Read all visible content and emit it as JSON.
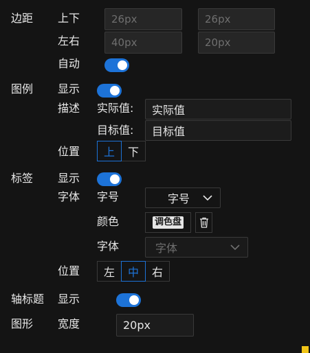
{
  "margin": {
    "section_label": "边距",
    "vertical_label": "上下",
    "horizontal_label": "左右",
    "auto_label": "自动",
    "auto_on": true,
    "top": {
      "placeholder": "26px"
    },
    "bottom": {
      "placeholder": "26px"
    },
    "left": {
      "placeholder": "40px"
    },
    "right": {
      "placeholder": "20px"
    }
  },
  "legend": {
    "section_label": "图例",
    "show_label": "显示",
    "show_on": true,
    "desc_label": "描述",
    "actual_label": "实际值:",
    "actual_value": "实际值",
    "target_label": "目标值:",
    "target_value": "目标值",
    "position_label": "位置",
    "position_options": [
      "上",
      "下"
    ],
    "position_selected": "上"
  },
  "label": {
    "section_label": "标签",
    "show_label": "显示",
    "show_on": true,
    "font_label": "字体",
    "size_label": "字号",
    "size_value": "字号",
    "color_label": "颜色",
    "color_button": "调色盘",
    "family_label": "字体",
    "family_placeholder": "字体",
    "position_label": "位置",
    "position_options": [
      "左",
      "中",
      "右"
    ],
    "position_selected": "中"
  },
  "axis_title": {
    "section_label": "轴标题",
    "show_label": "显示",
    "show_on": true
  },
  "shape": {
    "section_label": "图形",
    "width_label": "宽度",
    "width_value": "20px"
  },
  "icons": {
    "chevron": "chevron-down-icon",
    "trash": "trash-icon"
  },
  "colors": {
    "accent": "#1d73d8",
    "background": "#141414",
    "scroll_thumb": "#f0c417"
  }
}
